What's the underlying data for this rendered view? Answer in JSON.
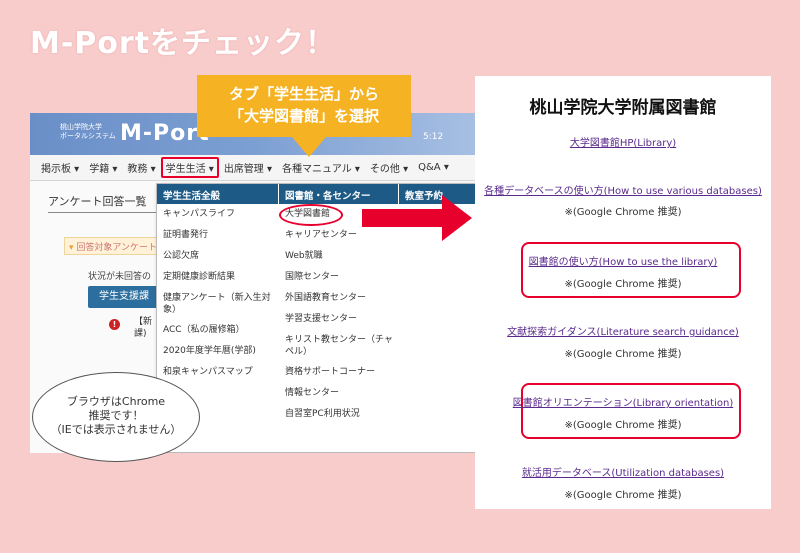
{
  "page": {
    "title": "M-Portをチェック！"
  },
  "portal": {
    "univ_line1": "桃山学院大学",
    "univ_line2": "ポータルシステム",
    "name": "M-Port",
    "clock": "5:12",
    "menu": [
      {
        "label": "掲示板 ▾"
      },
      {
        "label": "学籍 ▾"
      },
      {
        "label": "教務 ▾"
      },
      {
        "label": "学生生活 ▾"
      },
      {
        "label": "出席管理 ▾"
      },
      {
        "label": "各種マニュアル ▾"
      },
      {
        "label": "その他 ▾"
      },
      {
        "label": "Q&A ▾"
      }
    ],
    "survey_title": "アンケート回答一覧",
    "notice": "回答対象アンケート",
    "status_text": "状況が未回答の",
    "sub_button": "学生支援課",
    "alert_text_1": "【新",
    "alert_text_2": "課)"
  },
  "dropdown": {
    "col1": {
      "header": "学生生活全般",
      "items": [
        "キャンパスライフ",
        "証明書発行",
        "公認欠席",
        "定期健康診断結果",
        "健康アンケート（新入生対象）",
        "ACC（私の履修箱）",
        "2020年度学年暦(学部)",
        "和泉キャンパスマップ"
      ]
    },
    "col2": {
      "header": "図書館・各センター",
      "items": [
        "大学図書館",
        "キャリアセンター",
        "Web就職",
        "国際センター",
        "外国語教育センター",
        "学習支援センター",
        "キリスト教センター（チャペル）",
        "資格サポートコーナー",
        "情報センター",
        "自習室PC利用状況"
      ]
    },
    "col3": {
      "header": "教室予約"
    }
  },
  "callout": {
    "line1": "タブ「学生生活」から",
    "line2": "「大学図書館」を選択"
  },
  "bubble": {
    "line1": "ブラウザはChrome",
    "line2": "推奨です！",
    "line3": "（IEでは表示されません）"
  },
  "library": {
    "title": "桃山学院大学附属図書館",
    "links": [
      {
        "label": "大学図書館HP(Library)",
        "note": ""
      },
      {
        "label": "各種データベースの使い方(How to use various databases)",
        "note": "※(Google Chrome 推奨)"
      },
      {
        "label": "図書館の使い方(How to use the library)",
        "note": "※(Google Chrome 推奨)"
      },
      {
        "label": "文献探索ガイダンス(Literature search guidance)",
        "note": "※(Google Chrome 推奨)"
      },
      {
        "label": "図書館オリエンテーション(Library orientation)",
        "note": "※(Google Chrome 推奨)"
      },
      {
        "label": "就活用データベース(Utilization databases)",
        "note": "※(Google Chrome 推奨)"
      }
    ]
  },
  "colors": {
    "accent_red": "#e8002d",
    "callout_orange": "#f5b223",
    "menu_header_blue": "#1e5a86"
  },
  "icons": {
    "alert": "exclamation-circle-icon",
    "arrow": "red-right-arrow-icon"
  }
}
